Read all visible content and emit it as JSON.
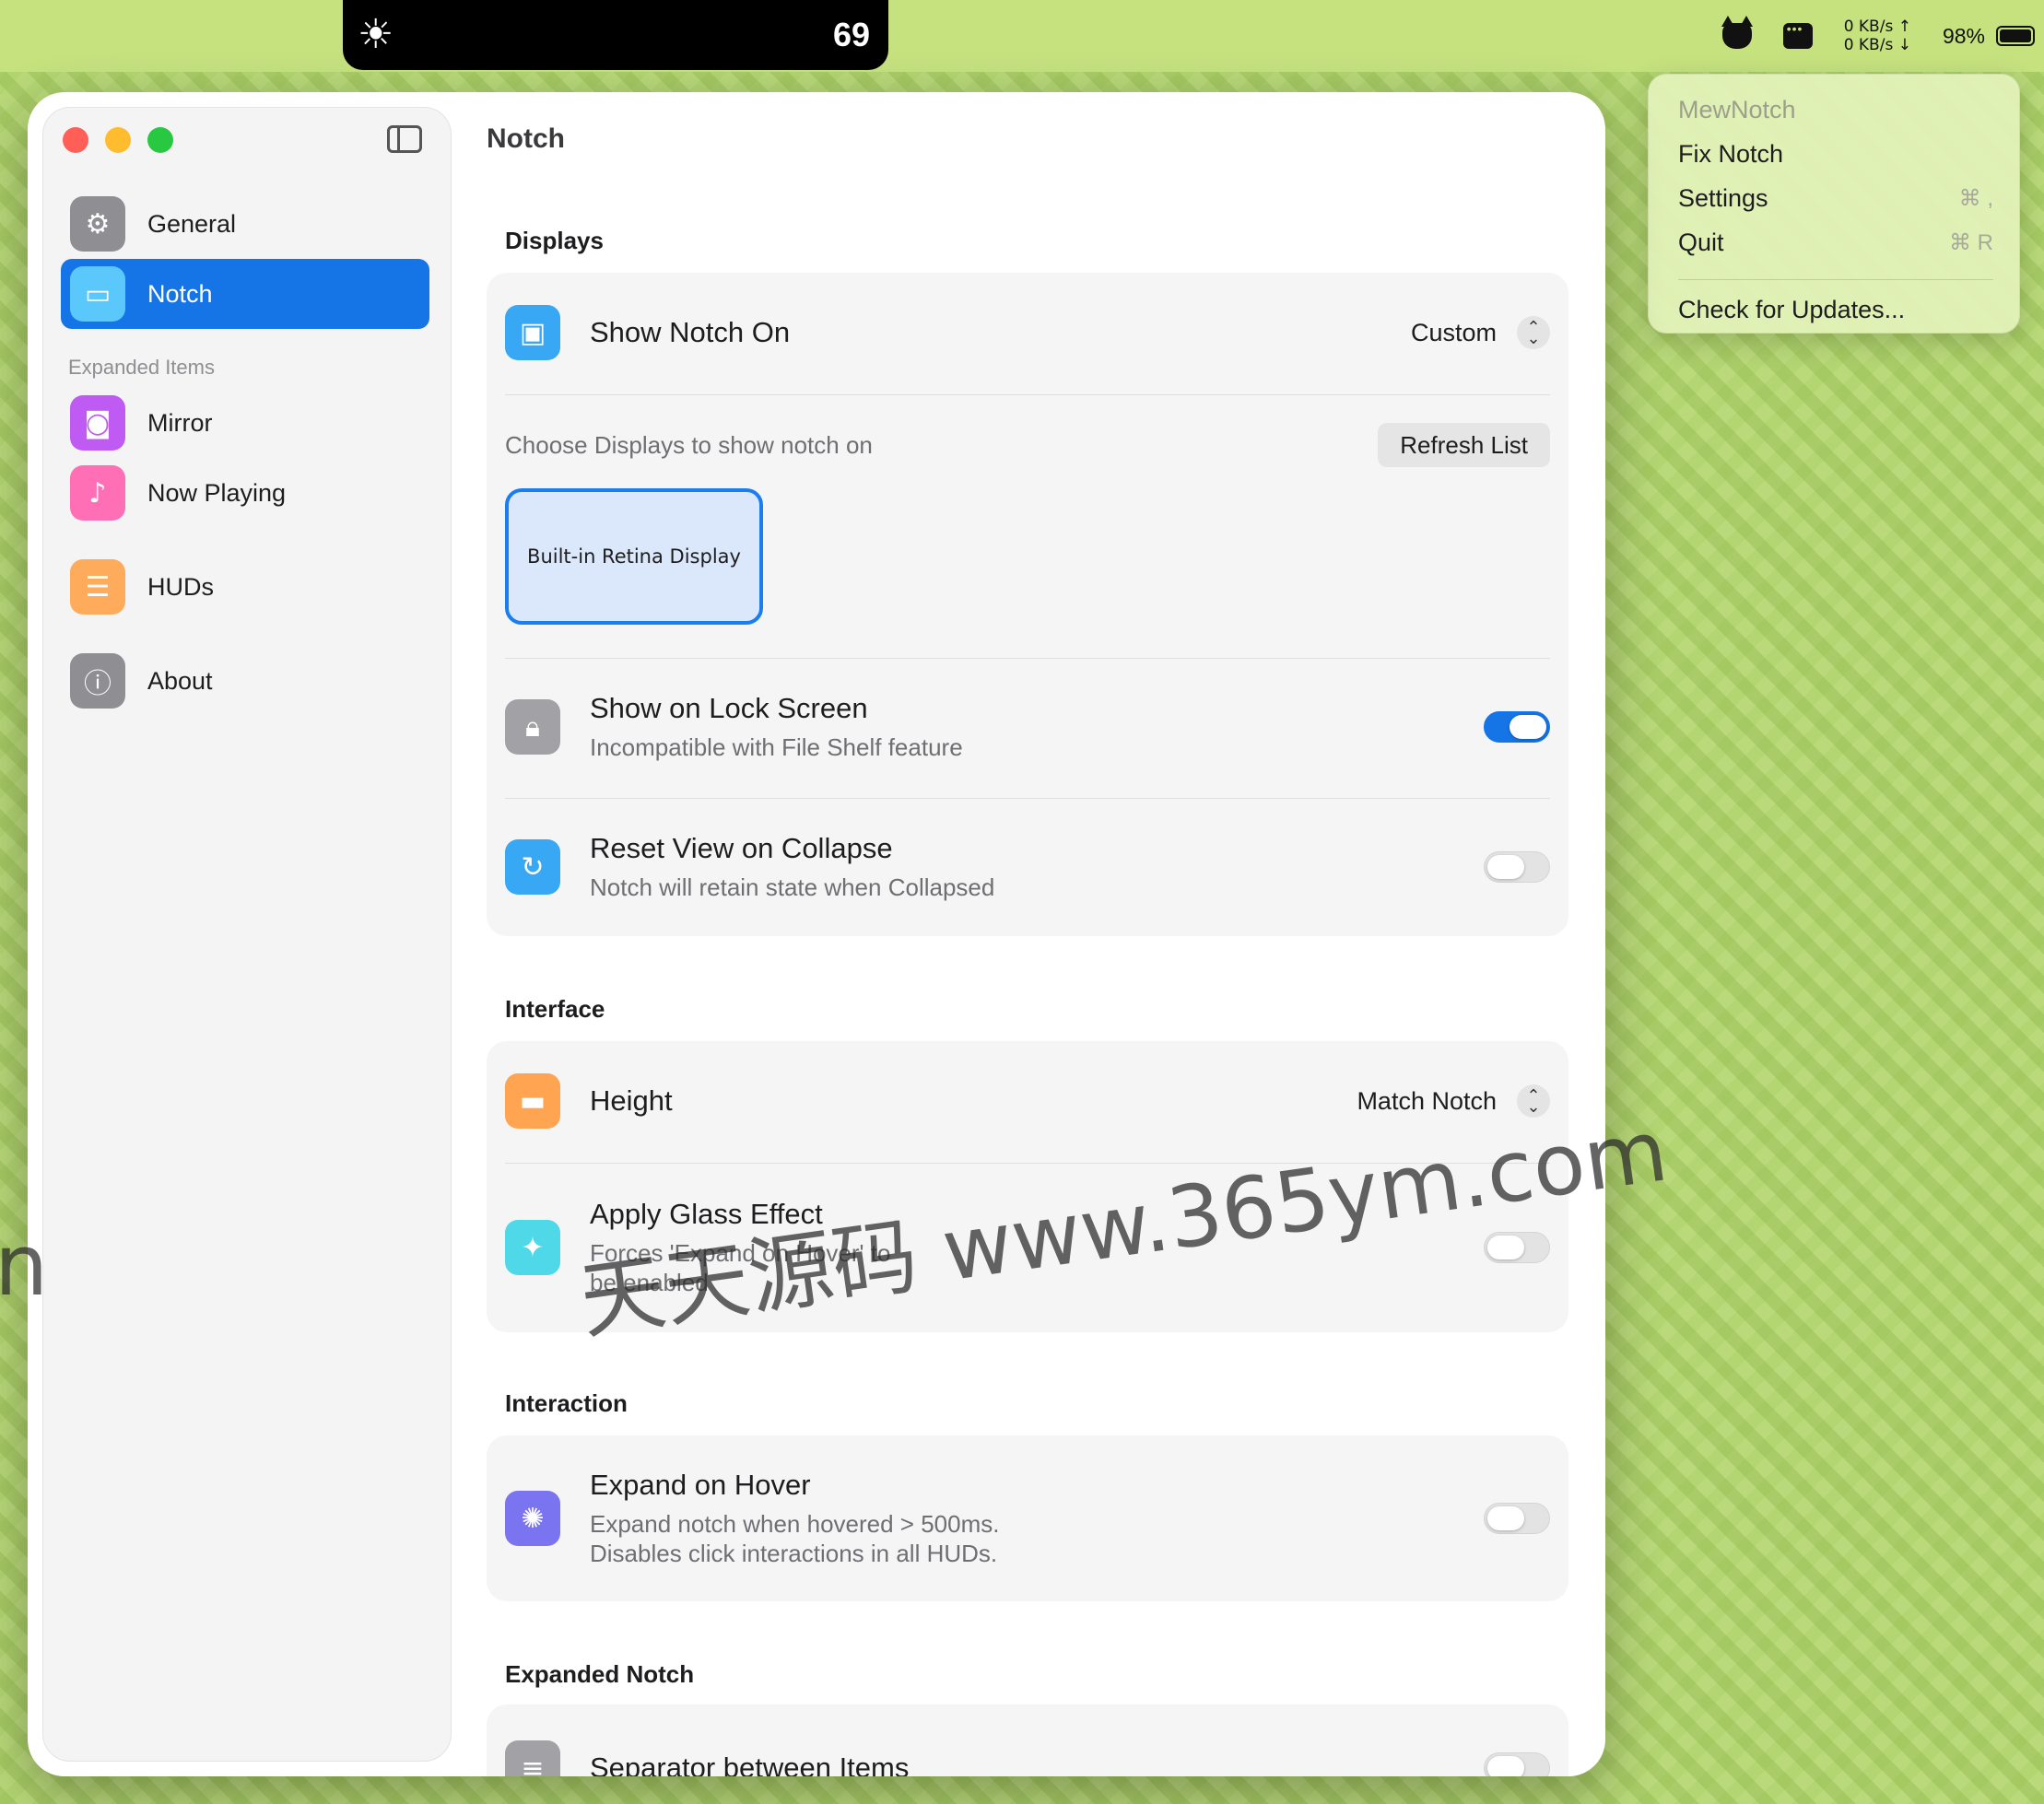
{
  "menubar": {
    "notch": {
      "brightness_icon": "sun-icon",
      "value": "69"
    },
    "net_up": "0 KB/s ↑",
    "net_down": "0 KB/s ↓",
    "battery_percent": "98%",
    "icons": [
      "cat-icon",
      "card-icon",
      "battery-icon"
    ]
  },
  "app_menu": {
    "header": "MewNotch",
    "items": [
      {
        "label": "Fix Notch",
        "shortcut": ""
      },
      {
        "label": "Settings",
        "shortcut": "⌘ ,"
      },
      {
        "label": "Quit",
        "shortcut": "⌘ R"
      }
    ],
    "check_updates": "Check for Updates..."
  },
  "sidebar": {
    "items": [
      {
        "label": "General",
        "icon": "gear-icon",
        "color": "#8e8e93"
      },
      {
        "label": "Notch",
        "icon": "laptop-icon",
        "color": "#5ac8fa",
        "active": true
      }
    ],
    "section_heading": "Expanded Items",
    "expanded_items": [
      {
        "label": "Mirror",
        "icon": "person-icon",
        "color": "#bf5af2"
      },
      {
        "label": "Now Playing",
        "icon": "music-note-icon",
        "color": "#ff6fb5"
      },
      {
        "label": "HUDs",
        "icon": "sliders-icon",
        "color": "#ffab5c"
      },
      {
        "label": "About",
        "icon": "info-icon",
        "color": "#8e8e93"
      }
    ]
  },
  "content": {
    "title": "Notch",
    "displays": {
      "label": "Displays",
      "show_notch_on": {
        "title": "Show Notch On",
        "value": "Custom"
      },
      "choose_label": "Choose Displays to show notch on",
      "refresh_button": "Refresh List",
      "display_card": "Built-in Retina Display",
      "lock_screen": {
        "title": "Show on Lock Screen",
        "subtitle": "Incompatible with File Shelf feature",
        "on": true
      },
      "reset_view": {
        "title": "Reset View on Collapse",
        "subtitle": "Notch will retain state when Collapsed",
        "on": false
      }
    },
    "interface": {
      "label": "Interface",
      "height": {
        "title": "Height",
        "value": "Match Notch"
      },
      "glass": {
        "title": "Apply Glass Effect",
        "subtitle_1": "Forces 'Expand on Hover' to",
        "subtitle_2": "be enabled",
        "on": false
      }
    },
    "interaction": {
      "label": "Interaction",
      "hover": {
        "title": "Expand on Hover",
        "subtitle_1": "Expand notch when hovered > 500ms.",
        "subtitle_2": "Disables click interactions in all HUDs.",
        "on": false
      }
    },
    "expanded_notch": {
      "label": "Expanded Notch",
      "separator": {
        "title": "Separator between Items",
        "on": false
      }
    }
  },
  "watermark": "天天源码 www.365ym.com",
  "watermark_edge": "n",
  "colors": {
    "accent": "#1574e6",
    "desktop": "#b9d97a"
  }
}
